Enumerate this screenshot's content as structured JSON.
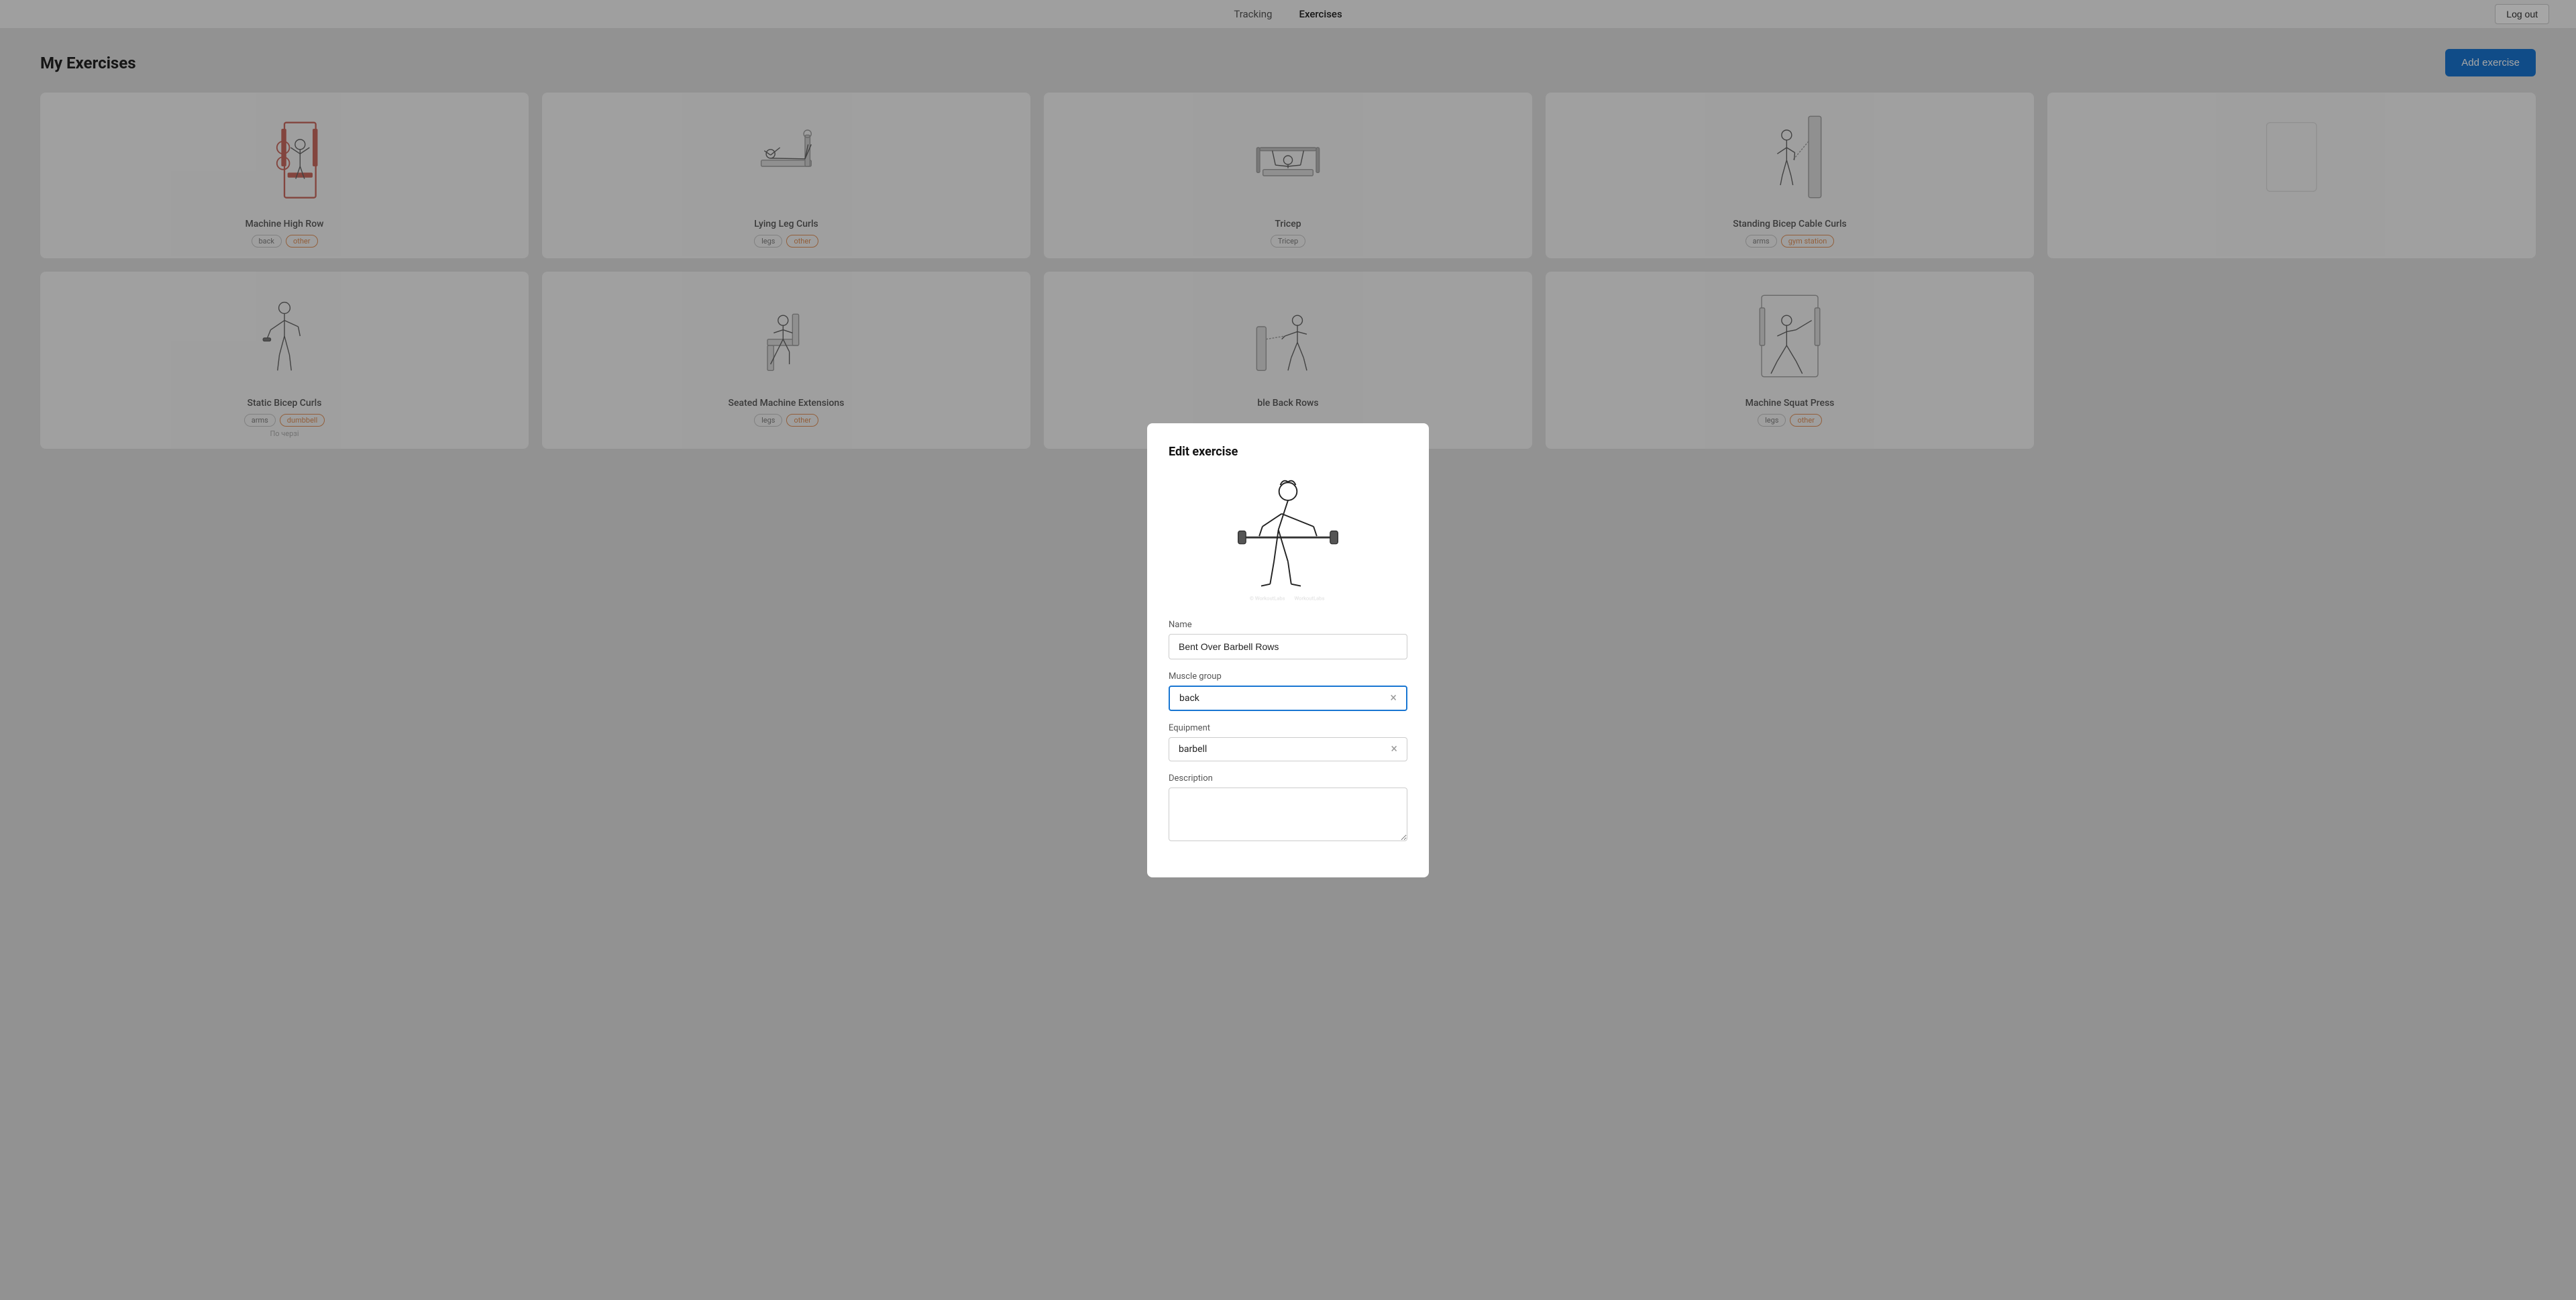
{
  "nav": {
    "links": [
      {
        "label": "Tracking",
        "active": false
      },
      {
        "label": "Exercises",
        "active": true
      }
    ],
    "logout_label": "Log out"
  },
  "page": {
    "title": "My Exercises",
    "add_button_label": "Add exercise"
  },
  "exercises": [
    {
      "name": "Machine High Row",
      "tags": [
        {
          "label": "back",
          "type": "normal"
        },
        {
          "label": "other",
          "type": "orange"
        }
      ],
      "figure": "machine_row"
    },
    {
      "name": "Lying Leg Curls",
      "tags": [
        {
          "label": "legs",
          "type": "normal"
        },
        {
          "label": "other",
          "type": "orange"
        }
      ],
      "figure": "lying_leg"
    },
    {
      "name": "",
      "tags": [
        {
          "label": "Tricep",
          "type": "normal"
        }
      ],
      "figure": "tricep"
    },
    {
      "name": "Standing Bicep Cable Curls",
      "tags": [
        {
          "label": "arms",
          "type": "normal"
        },
        {
          "label": "gym station",
          "type": "orange"
        }
      ],
      "figure": "cable_curls"
    },
    {
      "name": "",
      "tags": [],
      "figure": "empty"
    },
    {
      "name": "Static Bicep Curls",
      "tags": [
        {
          "label": "arms",
          "type": "normal"
        },
        {
          "label": "dumbbell",
          "type": "orange"
        }
      ],
      "extra": "По черзі",
      "figure": "static_bicep"
    },
    {
      "name": "Seated Machine Extensions",
      "tags": [
        {
          "label": "legs",
          "type": "normal"
        },
        {
          "label": "other",
          "type": "orange"
        }
      ],
      "figure": "seated_machine"
    },
    {
      "name": "ble Back Rows",
      "tags": [],
      "figure": "cable_back"
    },
    {
      "name": "Machine Squat Press",
      "tags": [
        {
          "label": "legs",
          "type": "normal"
        },
        {
          "label": "other",
          "type": "orange"
        }
      ],
      "figure": "squat_press"
    }
  ],
  "modal": {
    "title": "Edit exercise",
    "name_label": "Name",
    "name_value": "Bent Over Barbell Rows",
    "muscle_group_label": "Muscle group",
    "muscle_group_value": "back",
    "equipment_label": "Equipment",
    "equipment_value": "barbell",
    "description_label": "Description",
    "description_value": ""
  }
}
